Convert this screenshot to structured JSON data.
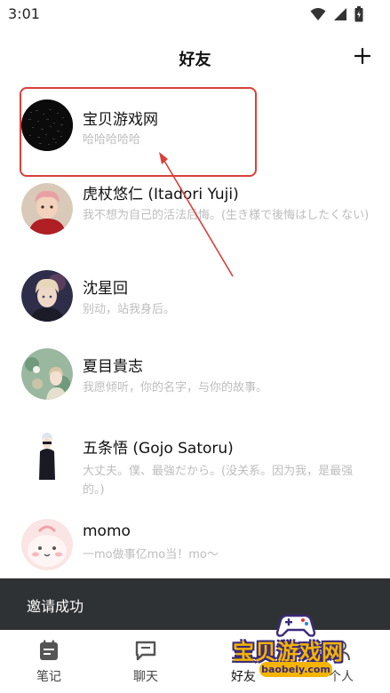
{
  "status_bar": {
    "time": "3:01",
    "icons": [
      "wifi-icon",
      "signal-icon",
      "battery-icon"
    ]
  },
  "header": {
    "title": "好友",
    "add_icon": "plus-icon"
  },
  "friends": [
    {
      "name": "宝贝游戏网",
      "message": "哈哈哈哈哈",
      "avatar": "dark-noise-avatar"
    },
    {
      "name": "虎杖悠仁 (Itadori Yuji)",
      "message": "我不想为自己的活法后悔。(生き様で後悔はしたくない)",
      "avatar": "itadori-avatar"
    },
    {
      "name": "沈星回",
      "message": "别动，站我身后。",
      "avatar": "shen-xinghui-avatar"
    },
    {
      "name": "夏目貴志",
      "message": "我愿倾听，你的名字，与你的故事。",
      "avatar": "natsume-avatar"
    },
    {
      "name": "五条悟 (Gojo Satoru)",
      "message": "大丈夫。僕、最強だから。(没关系。因为我，是最强的。)",
      "avatar": "gojo-avatar"
    },
    {
      "name": "momo",
      "message": "一mo做事亿mo当！mo～",
      "avatar": "momo-avatar"
    }
  ],
  "toast": {
    "text": "邀请成功"
  },
  "bottom_nav": [
    {
      "label": "笔记",
      "icon": "notes-icon"
    },
    {
      "label": "聊天",
      "icon": "chat-icon"
    },
    {
      "label": "好友",
      "icon": "friends-icon"
    },
    {
      "label": "个人",
      "icon": "person-icon"
    }
  ],
  "watermark": {
    "text": "宝贝游戏网",
    "url": "baobeiy.com"
  },
  "colors": {
    "highlight": "#d9403a",
    "toast_bg": "#2f3235",
    "secondary_text": "#bdbdbd",
    "watermark_yellow": "#f4b400",
    "watermark_purple": "#3a2a7a"
  }
}
